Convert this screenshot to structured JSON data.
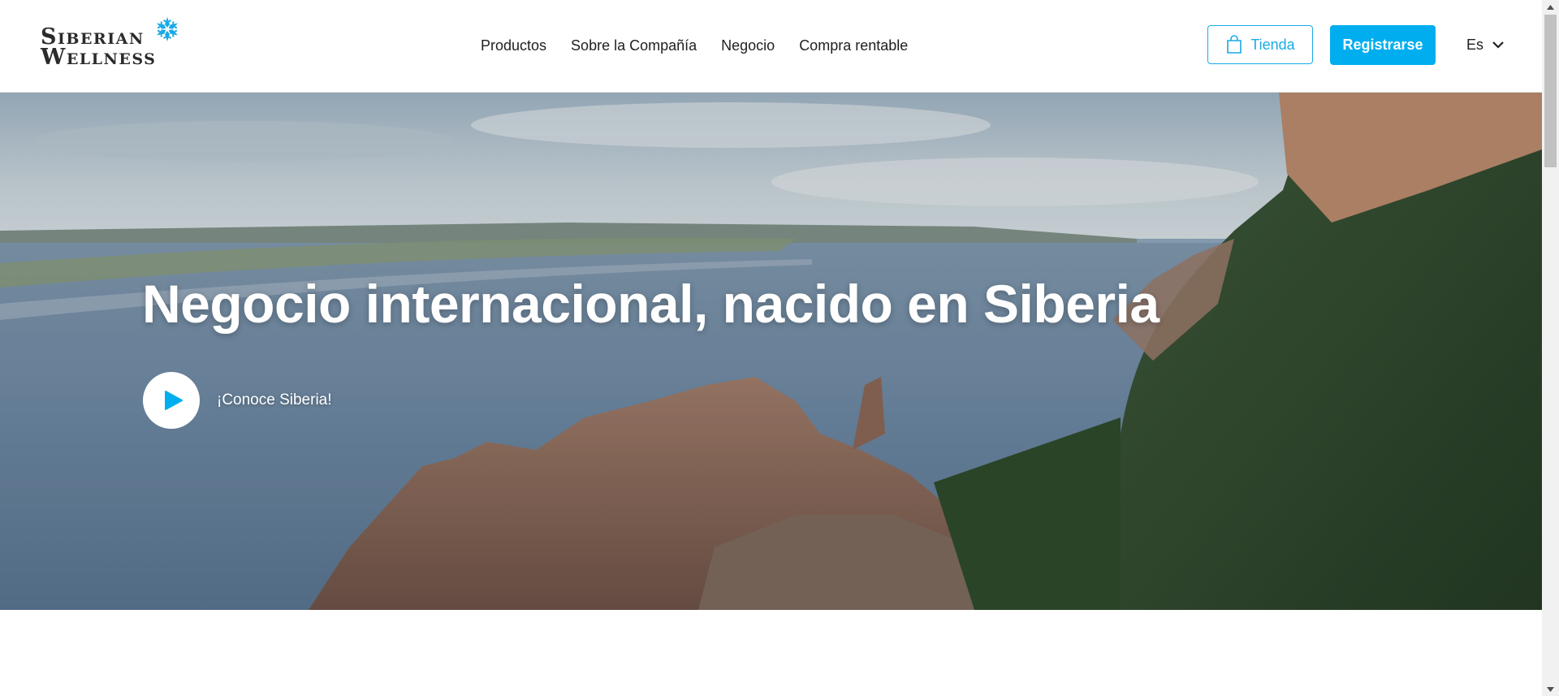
{
  "brand": {
    "line1": "Siberian",
    "line2": "Wellness",
    "accent_color": "#1aaae6"
  },
  "nav": {
    "items": [
      {
        "label": "Productos"
      },
      {
        "label": "Sobre la Compañía"
      },
      {
        "label": "Negocio"
      },
      {
        "label": "Compra rentable"
      }
    ]
  },
  "actions": {
    "shop_label": "Tienda",
    "shop_icon": "shopping-bag-icon",
    "register_label": "Registrarse",
    "register_color": "#00aeef",
    "language": "Es",
    "language_icon": "chevron-down-icon"
  },
  "hero": {
    "title": "Negocio internacional, nacido en Siberia",
    "play_label": "¡Conoce Siberia!",
    "play_icon": "play-icon"
  }
}
